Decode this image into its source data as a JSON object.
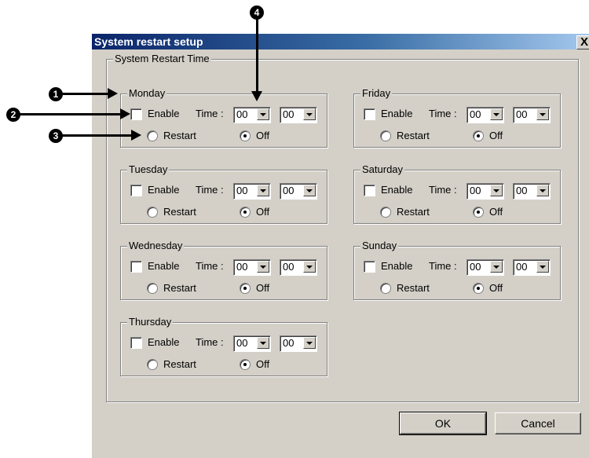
{
  "window": {
    "title": "System restart setup",
    "close_glyph": "X"
  },
  "outer_group": {
    "label": "System Restart Time"
  },
  "days": [
    {
      "name": "Monday",
      "enable_label": "Enable",
      "enabled": false,
      "time_label": "Time :",
      "hour": "00",
      "minute": "00",
      "restart_label": "Restart",
      "off_label": "Off",
      "selected": "Off"
    },
    {
      "name": "Tuesday",
      "enable_label": "Enable",
      "enabled": false,
      "time_label": "Time :",
      "hour": "00",
      "minute": "00",
      "restart_label": "Restart",
      "off_label": "Off",
      "selected": "Off"
    },
    {
      "name": "Wednesday",
      "enable_label": "Enable",
      "enabled": false,
      "time_label": "Time :",
      "hour": "00",
      "minute": "00",
      "restart_label": "Restart",
      "off_label": "Off",
      "selected": "Off"
    },
    {
      "name": "Thursday",
      "enable_label": "Enable",
      "enabled": false,
      "time_label": "Time :",
      "hour": "00",
      "minute": "00",
      "restart_label": "Restart",
      "off_label": "Off",
      "selected": "Off"
    },
    {
      "name": "Friday",
      "enable_label": "Enable",
      "enabled": false,
      "time_label": "Time :",
      "hour": "00",
      "minute": "00",
      "restart_label": "Restart",
      "off_label": "Off",
      "selected": "Off"
    },
    {
      "name": "Saturday",
      "enable_label": "Enable",
      "enabled": false,
      "time_label": "Time :",
      "hour": "00",
      "minute": "00",
      "restart_label": "Restart",
      "off_label": "Off",
      "selected": "Off"
    },
    {
      "name": "Sunday",
      "enable_label": "Enable",
      "enabled": false,
      "time_label": "Time :",
      "hour": "00",
      "minute": "00",
      "restart_label": "Restart",
      "off_label": "Off",
      "selected": "Off"
    }
  ],
  "buttons": {
    "ok": "OK",
    "cancel": "Cancel"
  },
  "callouts": [
    "1",
    "2",
    "3",
    "4"
  ],
  "colors": {
    "titlebar_start": "#0a246a",
    "titlebar_end": "#a6caf0",
    "dialog_bg": "#d4d0c8"
  }
}
